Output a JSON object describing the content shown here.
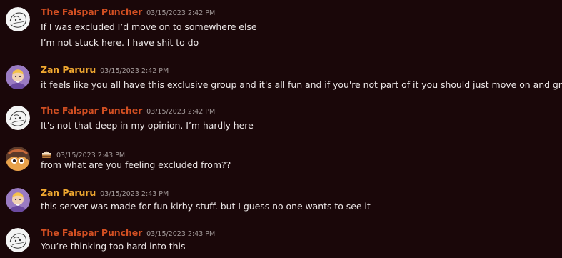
{
  "colors": {
    "background": "#1a0709",
    "falspar_name": "#d24f22",
    "zan_name": "#f0a830",
    "timestamp": "#a39a9a",
    "text": "#ece7e7"
  },
  "messages": [
    {
      "author": "The Falspar Puncher",
      "author_style": "falspar",
      "avatar_icon": "sketch-avatar-icon",
      "timestamp": "03/15/2023 2:42 PM",
      "lines": [
        "If I was excluded I’d move on to somewhere else",
        "I’m not stuck here. I have shit to do"
      ]
    },
    {
      "author": "Zan Paruru",
      "author_style": "zan",
      "avatar_icon": "wizard-avatar-icon",
      "timestamp": "03/15/2023 2:42 PM",
      "lines": [
        "it feels like you all have this exclusive group and it's all fun and if you're not part of it you should just move on and grow up"
      ]
    },
    {
      "author": "The Falspar Puncher",
      "author_style": "falspar",
      "avatar_icon": "sketch-avatar-icon",
      "timestamp": "03/15/2023 2:42 PM",
      "lines": [
        "It’s not that deep in my opinion. I’m hardly here"
      ]
    },
    {
      "author": "",
      "author_style": "emoji",
      "author_icon": "cake-emoji-icon",
      "avatar_icon": "character-avatar-icon",
      "timestamp": "03/15/2023 2:43 PM",
      "lines": [
        "from what are you feeling excluded from??"
      ]
    },
    {
      "author": "Zan Paruru",
      "author_style": "zan",
      "avatar_icon": "wizard-avatar-icon",
      "timestamp": "03/15/2023 2:43 PM",
      "lines": [
        "this server was made for fun kirby stuff. but I guess no one wants to see it"
      ]
    },
    {
      "author": "The Falspar Puncher",
      "author_style": "falspar",
      "avatar_icon": "sketch-avatar-icon",
      "timestamp": "03/15/2023 2:43 PM",
      "lines": [
        "You’re thinking too hard into this"
      ]
    }
  ]
}
